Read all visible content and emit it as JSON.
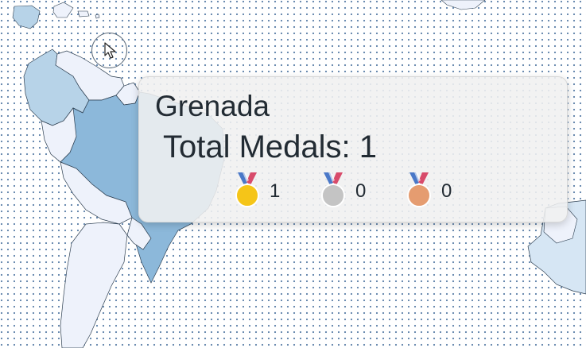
{
  "tooltip": {
    "country": "Grenada",
    "total_label": "Total Medals:",
    "total_value": "1",
    "medals": [
      {
        "type": "gold",
        "count": "1",
        "color": "#f5c518"
      },
      {
        "type": "silver",
        "count": "0",
        "color": "#c4c4c4"
      },
      {
        "type": "bronze",
        "count": "0",
        "color": "#e59c70"
      }
    ]
  },
  "colors": {
    "highlight": "#8cb8da",
    "light_region": "#b7d3e8",
    "pale_region": "#eef2fb",
    "border": "#2c3e50",
    "dot": "#5b7fa8",
    "ribbon_blue": "#4a78c8",
    "ribbon_red": "#d84b6b"
  },
  "icons": {
    "cursor": "arrow-pointer-icon",
    "medal": "medal-icon"
  }
}
